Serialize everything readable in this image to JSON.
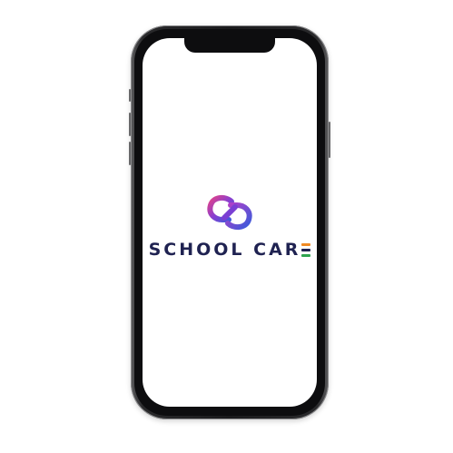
{
  "app": {
    "brand_name_main": "SCHOOL CAR",
    "logo_icon": "school-care-logo-icon"
  },
  "colors": {
    "brand_text": "#1f2251",
    "logo_gradient_start": "#e0428a",
    "logo_gradient_mid": "#8a3fd0",
    "logo_gradient_end": "#3b5bdb",
    "e_bar_top": "#f08a24",
    "e_bar_middle": "#1f2251",
    "e_bar_bottom": "#2ea44f"
  }
}
